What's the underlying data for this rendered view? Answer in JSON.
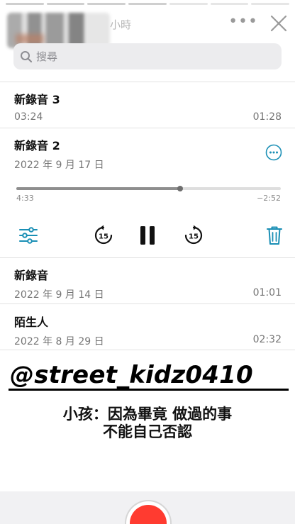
{
  "story": {
    "time_ago": "小時",
    "more_label": "•••"
  },
  "search": {
    "placeholder": "搜尋"
  },
  "recordings": [
    {
      "title": "新錄音 3",
      "date": "03:24",
      "duration": "01:28"
    },
    {
      "title": "新錄音 2",
      "date": "2022 年 9 月 17 日",
      "duration": ""
    },
    {
      "title": "新錄音",
      "date": "2022 年 9 月 14 日",
      "duration": "01:01"
    },
    {
      "title": "陌生人",
      "date": "2022 年 8 月 29 日",
      "duration": "02:32"
    }
  ],
  "player": {
    "elapsed": "4:33",
    "remaining": "−2:52",
    "progress_fraction": 0.62,
    "skip_back_label": "15",
    "skip_forward_label": "15"
  },
  "overlay": {
    "watermark": "@street_kidz0410",
    "subtitle_line1": "小孩：因為畢竟 做過的事",
    "subtitle_line2": "不能自己否認"
  },
  "colors": {
    "accent": "#1a8fb5",
    "record_red": "#ff3b30"
  }
}
